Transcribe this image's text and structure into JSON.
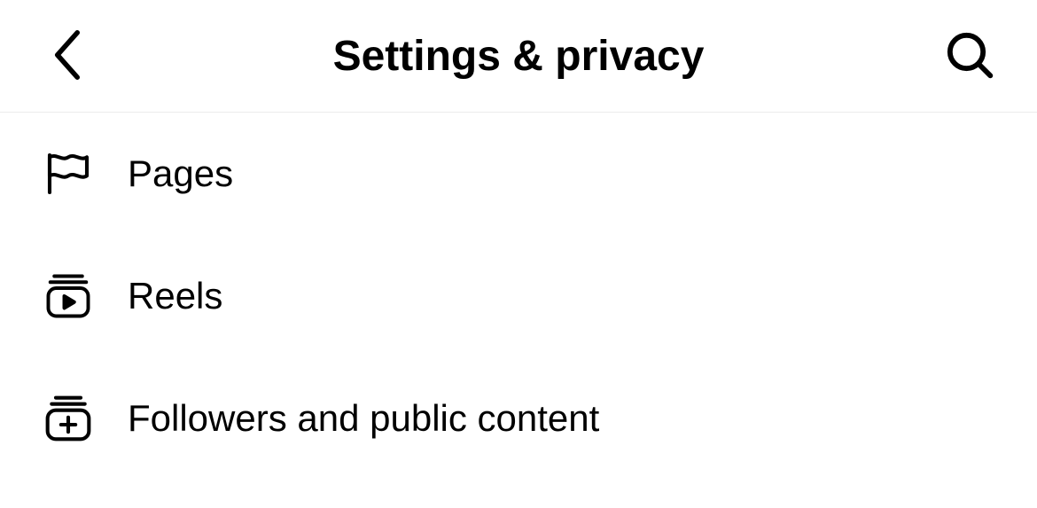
{
  "header": {
    "title": "Settings & privacy"
  },
  "menu": {
    "items": [
      {
        "label": "Pages",
        "icon": "flag-icon"
      },
      {
        "label": "Reels",
        "icon": "reels-icon"
      },
      {
        "label": "Followers and public content",
        "icon": "followers-icon"
      }
    ]
  }
}
